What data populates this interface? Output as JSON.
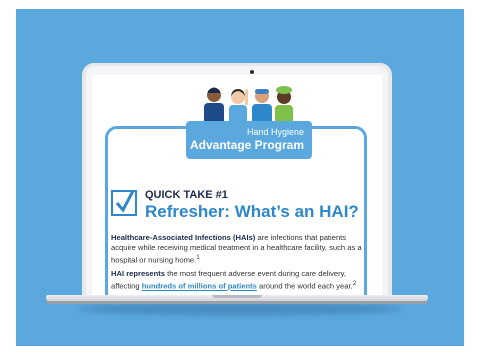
{
  "colors": {
    "stage": "#5aa8de",
    "accent": "#2e87c8",
    "navy": "#1e2a4a"
  },
  "badge": {
    "line1": "Hand Hygiene",
    "line2": "Advantage Program"
  },
  "quick_take": {
    "label": "QUICK TAKE #1",
    "title": "Refresher: What’s an HAI?"
  },
  "paragraph1": {
    "bold": "Healthcare-Associated Infections (HAIs)",
    "rest": " are infections that patients acquire while receiving medical treatment in a healthcare facility, such as a hospital or nursing home.",
    "sup": "1"
  },
  "paragraph2": {
    "bold": "HAI represents",
    "mid": " the most frequent adverse event during care delivery, affecting ",
    "highlight": "hundreds of millions of patients",
    "rest": " around the world each year.",
    "sup": "2"
  },
  "icons": {
    "check": "checkbox-check-icon",
    "people": "healthcare-workers-illustration"
  }
}
